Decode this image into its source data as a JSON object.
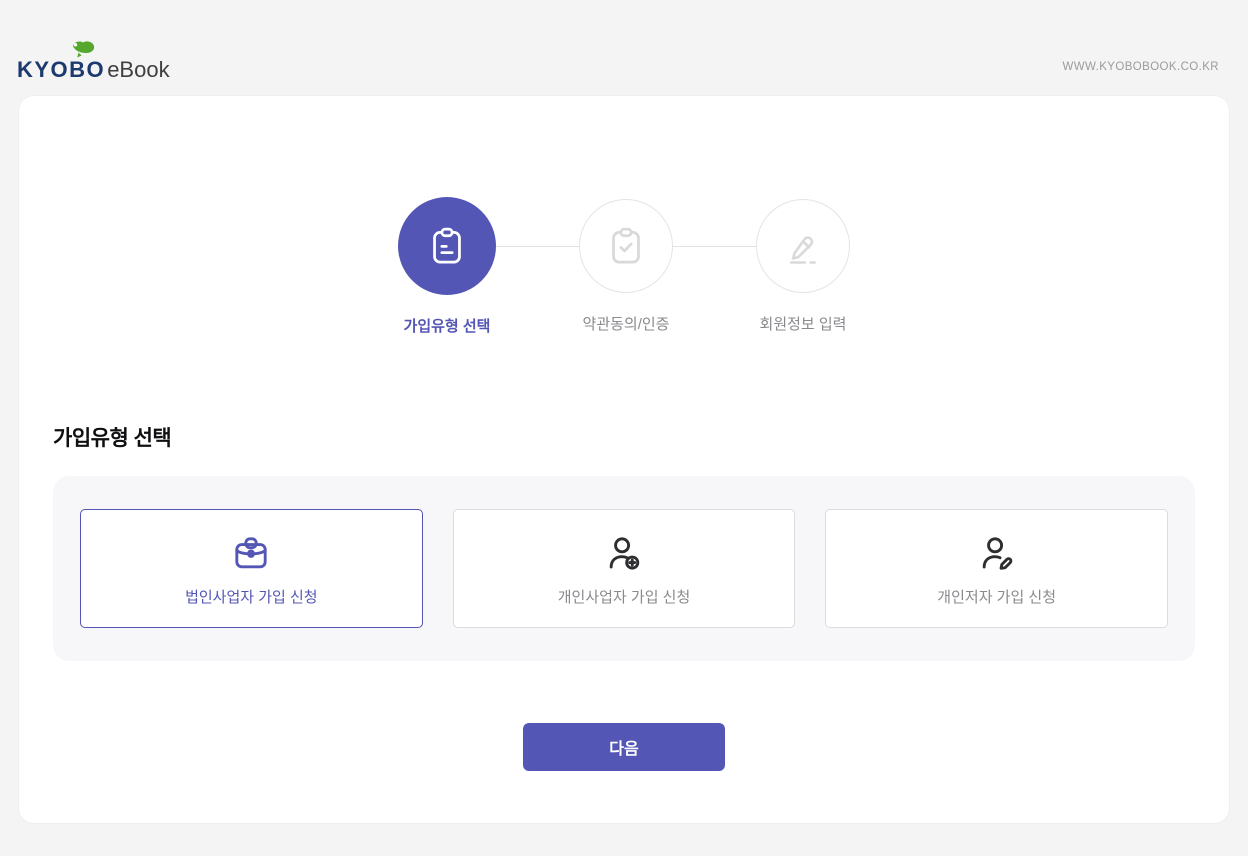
{
  "header": {
    "logo_kyobo": "KYOBO",
    "logo_ebook": "eBook",
    "site_url": "WWW.KYOBOBOOK.CO.KR"
  },
  "stepper": {
    "steps": [
      {
        "label": "가입유형 선택",
        "icon": "clipboard-icon",
        "state": "active"
      },
      {
        "label": "약관동의/인증",
        "icon": "clipboard-check-icon",
        "state": "upcoming"
      },
      {
        "label": "회원정보 입력",
        "icon": "pencil-icon",
        "state": "upcoming"
      }
    ]
  },
  "section": {
    "title": "가입유형 선택"
  },
  "options": [
    {
      "label": "법인사업자 가입 신청",
      "icon": "briefcase-icon",
      "selected": true
    },
    {
      "label": "개인사업자 가입 신청",
      "icon": "user-plus-icon",
      "selected": false
    },
    {
      "label": "개인저자 가입 신청",
      "icon": "user-edit-icon",
      "selected": false
    }
  ],
  "actions": {
    "next_label": "다음"
  },
  "colors": {
    "accent": "#5456b5",
    "page_background": "#f4f4f5",
    "panel_background": "#f7f7f9",
    "inactive_gray": "#8a8a8e",
    "border_gray": "#dcdce0",
    "logo_navy": "#1d3a6e",
    "logo_green": "#55a82d"
  }
}
